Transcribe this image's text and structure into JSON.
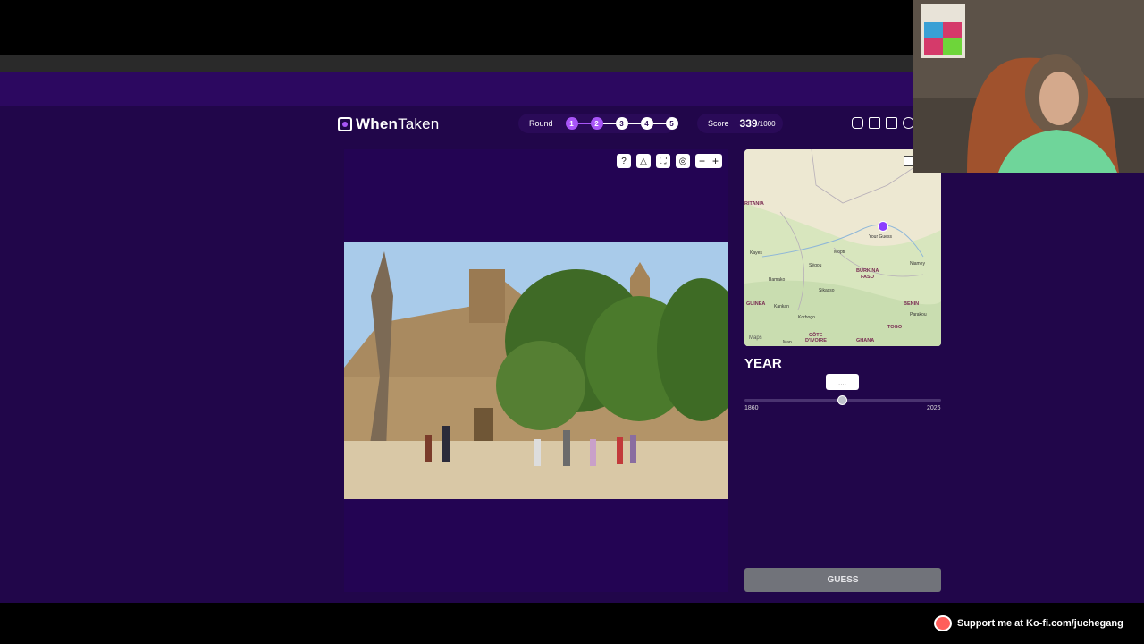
{
  "app": {
    "brand_bold": "When",
    "brand_light": "Taken"
  },
  "round": {
    "label": "Round",
    "steps": [
      {
        "num": "1",
        "state": "done"
      },
      {
        "num": "2",
        "state": "done"
      },
      {
        "num": "3",
        "state": "current"
      },
      {
        "num": "4",
        "state": "todo"
      },
      {
        "num": "5",
        "state": "todo"
      }
    ]
  },
  "score": {
    "label": "Score",
    "value": "339",
    "total": "/1000"
  },
  "toolbar_icons": [
    "gamepad-icon",
    "share-icon",
    "stats-icon",
    "settings-icon"
  ],
  "photo_tools": [
    "hint-icon",
    "warning-icon",
    "fullscreen-icon",
    "focus-icon"
  ],
  "zoom": {
    "minus": "−",
    "plus": "+"
  },
  "map": {
    "credit": "Maps",
    "pin_label": "Your Guess",
    "labels": [
      "RITANIA",
      "Mopti",
      "Kayes",
      "BURKINA",
      "FASO",
      "Niamey",
      "Bamako",
      "Sikasso",
      "GUINEA",
      "Kankan",
      "Korhogo",
      "BENIN",
      "Parakou",
      "TOGO",
      "CÔTE",
      "D'IVOIRE",
      "GHANA",
      "Man",
      "Ségou"
    ]
  },
  "year": {
    "title": "YEAR",
    "bubble": "....",
    "min": "1860",
    "max": "2026",
    "value_fraction": 0.49
  },
  "guess_button": "GUESS",
  "kofi": "Support me at Ko-fi.com/juchegang",
  "colors": {
    "accent": "#a855f7",
    "background": "#21064a",
    "button": "#71737a"
  }
}
